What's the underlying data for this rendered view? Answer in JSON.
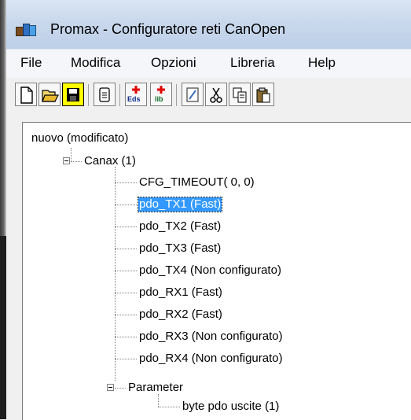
{
  "window": {
    "title": "Promax - Configuratore reti CanOpen",
    "icon": "network-app-icon"
  },
  "menu": [
    "File",
    "Modifica",
    "Opzioni",
    "Libreria",
    "Help"
  ],
  "toolbar": {
    "buttons": [
      {
        "icon": "new-file-icon"
      },
      {
        "icon": "open-folder-icon"
      },
      {
        "icon": "save-icon",
        "active": true
      },
      {
        "icon": "properties-icon"
      },
      {
        "icon": "add-eds-icon",
        "label": "Eds"
      },
      {
        "icon": "add-lib-icon",
        "label": "lib"
      },
      {
        "icon": "edit-icon"
      },
      {
        "icon": "cut-icon"
      },
      {
        "icon": "copy-icon"
      },
      {
        "icon": "paste-icon"
      }
    ],
    "eds_label": "Eds",
    "lib_label": "lib"
  },
  "tree": {
    "root": "nuovo (modificato)",
    "device": "Canax (1)",
    "items": [
      "CFG_TIMEOUT( 0, 0)",
      "pdo_TX1 (Fast)",
      "pdo_TX2 (Fast)",
      "pdo_TX3 (Fast)",
      "pdo_TX4 (Non configurato)",
      "pdo_RX1 (Fast)",
      "pdo_RX2 (Fast)",
      "pdo_RX3 (Non configurato)",
      "pdo_RX4 (Non configurato)"
    ],
    "selected_index": 1,
    "parameter": "Parameter",
    "parameter_children": [
      "byte pdo uscite (1)"
    ]
  },
  "colors": {
    "selection": "#3399ff",
    "active_button": "#ffff00"
  }
}
